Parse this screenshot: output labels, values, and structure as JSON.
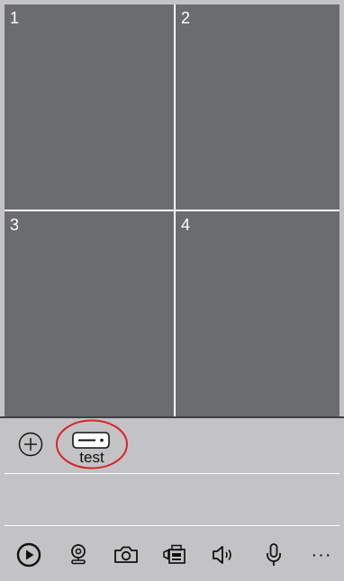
{
  "grid": {
    "cells": [
      {
        "label": "1"
      },
      {
        "label": "2"
      },
      {
        "label": "3"
      },
      {
        "label": "4"
      }
    ]
  },
  "devices": [
    {
      "name": "test",
      "icon": "nvr-device-icon",
      "highlighted": true
    }
  ],
  "toolbar": {
    "items": [
      {
        "icon": "play-icon"
      },
      {
        "icon": "webcam-icon"
      },
      {
        "icon": "camera-icon"
      },
      {
        "icon": "video-record-icon"
      },
      {
        "icon": "speaker-icon"
      },
      {
        "icon": "microphone-icon"
      },
      {
        "icon": "more-icon",
        "text": "···"
      }
    ]
  },
  "colors": {
    "panel_bg": "#c3c3c5",
    "cell_bg": "#6b6c70",
    "highlight_ring": "#d8222a"
  }
}
